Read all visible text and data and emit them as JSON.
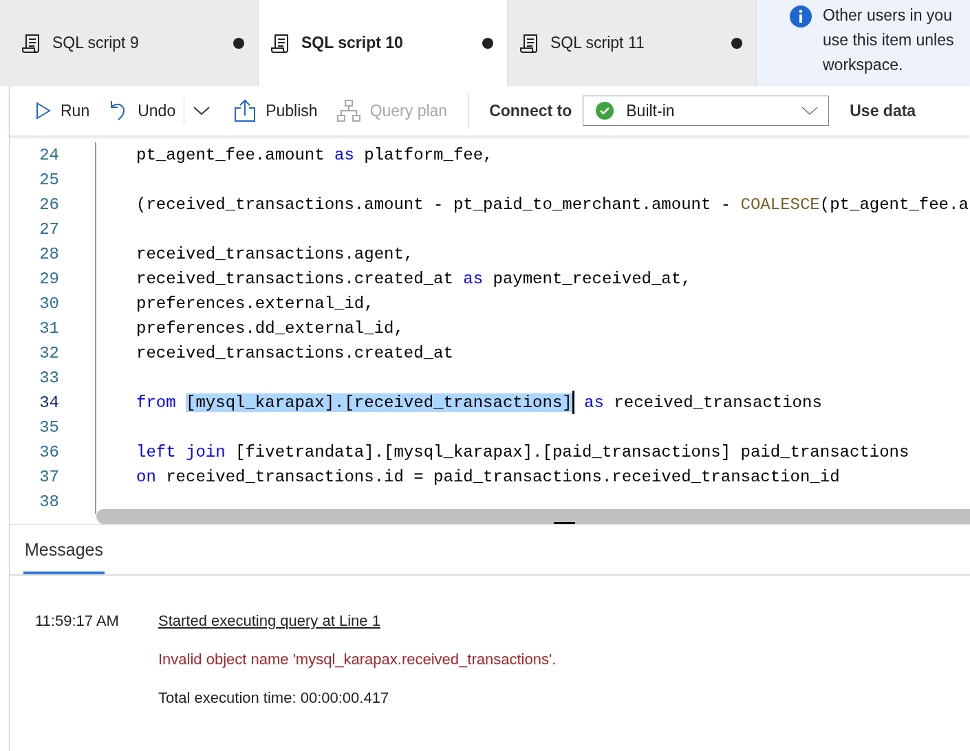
{
  "tabs": [
    {
      "label": "SQL script 9",
      "selected": false,
      "modified": true
    },
    {
      "label": "SQL script 10",
      "selected": true,
      "modified": true
    },
    {
      "label": "SQL script 11",
      "selected": false,
      "modified": true
    }
  ],
  "notice": {
    "lines": [
      "Other users in you",
      "use this item unles",
      "workspace."
    ]
  },
  "toolbar": {
    "items": [
      {
        "kind": "run",
        "label": "Run",
        "disabled": false
      },
      {
        "kind": "undo",
        "label": "Undo",
        "disabled": false
      },
      {
        "kind": "more"
      },
      {
        "kind": "publish",
        "label": "Publish",
        "disabled": false
      },
      {
        "kind": "plan",
        "label": "Query plan",
        "disabled": true
      }
    ],
    "connect_label": "Connect to",
    "connection": {
      "value": "Built-in",
      "connected": true
    },
    "database_label": "Use data"
  },
  "code": {
    "lines": [
      {
        "number": "24",
        "current": false,
        "tokens": [
          {
            "kind": "text",
            "text": "pt_agent_fee.amount "
          },
          {
            "kind": "keyword",
            "text": "as"
          },
          {
            "kind": "text",
            "text": " platform_fee,"
          }
        ]
      },
      {
        "number": "25",
        "current": false
      },
      {
        "number": "26",
        "current": false,
        "tokens": [
          {
            "kind": "text",
            "text": "(received_transactions.amount - pt_paid_to_merchant.amount - "
          },
          {
            "kind": "function",
            "text": "COALESCE"
          },
          {
            "kind": "text",
            "text": "(pt_agent_fee.a"
          }
        ]
      },
      {
        "number": "27",
        "current": false
      },
      {
        "number": "28",
        "current": false,
        "tokens": [
          {
            "kind": "text",
            "text": "received_transactions.agent,"
          }
        ]
      },
      {
        "number": "29",
        "current": false,
        "tokens": [
          {
            "kind": "text",
            "text": "received_transactions.created_at "
          },
          {
            "kind": "keyword",
            "text": "as"
          },
          {
            "kind": "text",
            "text": " payment_received_at,"
          }
        ]
      },
      {
        "number": "30",
        "current": false,
        "tokens": [
          {
            "kind": "text",
            "text": "preferences.external_id,"
          }
        ]
      },
      {
        "number": "31",
        "current": false,
        "tokens": [
          {
            "kind": "text",
            "text": "preferences.dd_external_id,"
          }
        ]
      },
      {
        "number": "32",
        "current": false,
        "tokens": [
          {
            "kind": "text",
            "text": "received_transactions.created_at"
          }
        ]
      },
      {
        "number": "33",
        "current": false
      },
      {
        "number": "34",
        "current": true,
        "tokens": [
          {
            "kind": "keyword",
            "text": "from "
          },
          {
            "kind": "selected",
            "text": "[mysql_karapax].[received_transactions]"
          },
          {
            "kind": "keyword",
            "text": " as"
          },
          {
            "kind": "text",
            "text": " received_transactions"
          }
        ]
      },
      {
        "number": "35",
        "current": false
      },
      {
        "number": "36",
        "current": false,
        "tokens": [
          {
            "kind": "keyword",
            "text": "left join"
          },
          {
            "kind": "text",
            "text": " [fivetrandata].[mysql_karapax].[paid_transactions] paid_transactions"
          }
        ]
      },
      {
        "number": "37",
        "current": false,
        "tokens": [
          {
            "kind": "keyword",
            "text": "on"
          },
          {
            "kind": "text",
            "text": " received_transactions.id = paid_transactions.received_transaction_id"
          }
        ]
      },
      {
        "number": "38",
        "current": false
      }
    ]
  },
  "messages": {
    "tabs": [
      {
        "label": "Messages",
        "selected": true
      }
    ],
    "entries": [
      {
        "time": "11:59:17 AM",
        "lines": [
          {
            "kind": "link",
            "text": "Started executing query at Line 1"
          },
          {
            "kind": "error",
            "text": "Invalid object name 'mysql_karapax.received_transactions'."
          },
          {
            "kind": "info",
            "text": "Total execution time: 00:00:00.417"
          }
        ]
      }
    ]
  }
}
